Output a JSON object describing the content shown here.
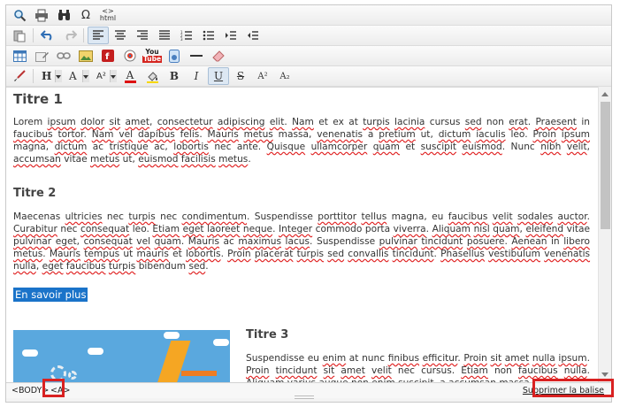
{
  "toolbar": {
    "row1": [
      {
        "name": "find-icon",
        "glyph": "🔍"
      },
      {
        "name": "print-icon",
        "glyph": "🖶"
      },
      {
        "name": "binoculars-icon",
        "glyph": "⛏"
      },
      {
        "name": "omega-icon",
        "glyph": "Ω"
      },
      {
        "name": "html-icon",
        "glyph": "<>"
      }
    ],
    "html_label": "html",
    "heading_btn": "H",
    "font_btn": "A",
    "size_btn": "A²",
    "color_btn": "A",
    "bold": "B",
    "italic": "I",
    "underline": "U",
    "strike": "S",
    "superscript": "A²",
    "subscript": "A₂",
    "youtube_top": "You",
    "youtube_bottom": "Tube"
  },
  "content": {
    "title1": "Titre 1",
    "para1": [
      {
        "t": "Lorem "
      },
      {
        "t": "ipsum",
        "u": true
      },
      {
        "t": " "
      },
      {
        "t": "dolor",
        "u": true
      },
      {
        "t": " "
      },
      {
        "t": "sit",
        "u": true
      },
      {
        "t": " "
      },
      {
        "t": "amet",
        "u": true
      },
      {
        "t": ", "
      },
      {
        "t": "consectetur",
        "u": true
      },
      {
        "t": " "
      },
      {
        "t": "adipiscing",
        "u": true
      },
      {
        "t": " "
      },
      {
        "t": "elit",
        "u": true
      },
      {
        "t": ". "
      },
      {
        "t": "Nam",
        "u": true
      },
      {
        "t": " et ex at "
      },
      {
        "t": "turpis",
        "u": true
      },
      {
        "t": " "
      },
      {
        "t": "lacinia",
        "u": true
      },
      {
        "t": " cursus "
      },
      {
        "t": "sed",
        "u": true
      },
      {
        "t": " non "
      },
      {
        "t": "erat",
        "u": true
      },
      {
        "t": ". "
      },
      {
        "t": "Praesent",
        "u": true
      },
      {
        "t": " in "
      },
      {
        "t": "faucibus",
        "u": true
      },
      {
        "t": " "
      },
      {
        "t": "tortor",
        "u": true
      },
      {
        "t": ". "
      },
      {
        "t": "Nam",
        "u": true
      },
      {
        "t": " "
      },
      {
        "t": "vel",
        "u": true
      },
      {
        "t": " "
      },
      {
        "t": "dapibus",
        "u": true
      },
      {
        "t": " "
      },
      {
        "t": "felis",
        "u": true
      },
      {
        "t": ". "
      },
      {
        "t": "Mauris",
        "u": true
      },
      {
        "t": " "
      },
      {
        "t": "metus",
        "u": true
      },
      {
        "t": " massa, "
      },
      {
        "t": "venenatis",
        "u": true
      },
      {
        "t": " a "
      },
      {
        "t": "pretium",
        "u": true
      },
      {
        "t": " ut, "
      },
      {
        "t": "dictum",
        "u": true
      },
      {
        "t": " "
      },
      {
        "t": "iaculis",
        "u": true
      },
      {
        "t": " leo. "
      },
      {
        "t": "Proin",
        "u": true
      },
      {
        "t": " "
      },
      {
        "t": "ipsum",
        "u": true
      },
      {
        "t": " magna, "
      },
      {
        "t": "dictum",
        "u": true
      },
      {
        "t": " ac "
      },
      {
        "t": "tristique",
        "u": true
      },
      {
        "t": " ac, "
      },
      {
        "t": "lobortis",
        "u": true
      },
      {
        "t": " nec ante. "
      },
      {
        "t": "Quisque",
        "u": true
      },
      {
        "t": " "
      },
      {
        "t": "ullamcorper",
        "u": true
      },
      {
        "t": " "
      },
      {
        "t": "quam",
        "u": true
      },
      {
        "t": " et "
      },
      {
        "t": "suscipit",
        "u": true
      },
      {
        "t": " "
      },
      {
        "t": "euismod",
        "u": true
      },
      {
        "t": ". Nunc "
      },
      {
        "t": "nibh",
        "u": true
      },
      {
        "t": " "
      },
      {
        "t": "velit",
        "u": true
      },
      {
        "t": ", "
      },
      {
        "t": "accumsan",
        "u": true
      },
      {
        "t": " vitae "
      },
      {
        "t": "metus",
        "u": true
      },
      {
        "t": " ut, "
      },
      {
        "t": "euismod",
        "u": true
      },
      {
        "t": " "
      },
      {
        "t": "facilisis",
        "u": true
      },
      {
        "t": " "
      },
      {
        "t": "metus",
        "u": true
      },
      {
        "t": "."
      }
    ],
    "title2": "Titre 2",
    "para2": [
      {
        "t": "Maecenas "
      },
      {
        "t": "ultricies",
        "u": true
      },
      {
        "t": " nec "
      },
      {
        "t": "turpis",
        "u": true
      },
      {
        "t": " nec "
      },
      {
        "t": "condimentum",
        "u": true
      },
      {
        "t": ". Suspendisse "
      },
      {
        "t": "porttitor",
        "u": true
      },
      {
        "t": " "
      },
      {
        "t": "tellus",
        "u": true
      },
      {
        "t": " magna, eu "
      },
      {
        "t": "faucibus",
        "u": true
      },
      {
        "t": " "
      },
      {
        "t": "velit",
        "u": true
      },
      {
        "t": " "
      },
      {
        "t": "sodales",
        "u": true
      },
      {
        "t": " "
      },
      {
        "t": "auctor",
        "u": true
      },
      {
        "t": ". "
      },
      {
        "t": "Curabitur",
        "u": true
      },
      {
        "t": " nec "
      },
      {
        "t": "consequat",
        "u": true
      },
      {
        "t": " leo. "
      },
      {
        "t": "Etiam",
        "u": true
      },
      {
        "t": " "
      },
      {
        "t": "eget",
        "u": true
      },
      {
        "t": " "
      },
      {
        "t": "laoreet",
        "u": true
      },
      {
        "t": " "
      },
      {
        "t": "neque",
        "u": true
      },
      {
        "t": ". "
      },
      {
        "t": "Integer",
        "u": true
      },
      {
        "t": " commodo porta "
      },
      {
        "t": "viverra",
        "u": true
      },
      {
        "t": ". "
      },
      {
        "t": "Aliquam",
        "u": true
      },
      {
        "t": " "
      },
      {
        "t": "nisl",
        "u": true
      },
      {
        "t": " "
      },
      {
        "t": "quam",
        "u": true
      },
      {
        "t": ", "
      },
      {
        "t": "eleifend",
        "u": true
      },
      {
        "t": " vitae "
      },
      {
        "t": "pulvinar",
        "u": true
      },
      {
        "t": " "
      },
      {
        "t": "eget",
        "u": true
      },
      {
        "t": ", "
      },
      {
        "t": "consequat",
        "u": true
      },
      {
        "t": " "
      },
      {
        "t": "vel",
        "u": true
      },
      {
        "t": " "
      },
      {
        "t": "quam",
        "u": true
      },
      {
        "t": ". "
      },
      {
        "t": "Mauris",
        "u": true
      },
      {
        "t": " ac "
      },
      {
        "t": "maximus",
        "u": true
      },
      {
        "t": " "
      },
      {
        "t": "lacus",
        "u": true
      },
      {
        "t": ". Suspendisse "
      },
      {
        "t": "pulvinar",
        "u": true
      },
      {
        "t": " "
      },
      {
        "t": "tincidunt",
        "u": true
      },
      {
        "t": " "
      },
      {
        "t": "posuere",
        "u": true
      },
      {
        "t": ". "
      },
      {
        "t": "Aenean",
        "u": true
      },
      {
        "t": " in "
      },
      {
        "t": "libero",
        "u": true
      },
      {
        "t": " "
      },
      {
        "t": "metus",
        "u": true
      },
      {
        "t": ". "
      },
      {
        "t": "Mauris",
        "u": true
      },
      {
        "t": " "
      },
      {
        "t": "tempus",
        "u": true
      },
      {
        "t": " ut "
      },
      {
        "t": "mauris",
        "u": true
      },
      {
        "t": " et "
      },
      {
        "t": "lobortis",
        "u": true
      },
      {
        "t": ". "
      },
      {
        "t": "Proin",
        "u": true
      },
      {
        "t": " "
      },
      {
        "t": "placerat",
        "u": true
      },
      {
        "t": " "
      },
      {
        "t": "turpis",
        "u": true
      },
      {
        "t": " "
      },
      {
        "t": "sed",
        "u": true
      },
      {
        "t": " "
      },
      {
        "t": "convallis",
        "u": true
      },
      {
        "t": " "
      },
      {
        "t": "tincidunt",
        "u": true
      },
      {
        "t": ". "
      },
      {
        "t": "Phasellus",
        "u": true
      },
      {
        "t": " "
      },
      {
        "t": "vestibulum",
        "u": true
      },
      {
        "t": " "
      },
      {
        "t": "venenatis",
        "u": true
      },
      {
        "t": " "
      },
      {
        "t": "nulla",
        "u": true
      },
      {
        "t": ", "
      },
      {
        "t": "eget",
        "u": true
      },
      {
        "t": " "
      },
      {
        "t": "faucibus",
        "u": true
      },
      {
        "t": " "
      },
      {
        "t": "turpis",
        "u": true
      },
      {
        "t": " bibendum "
      },
      {
        "t": "sed",
        "u": true
      },
      {
        "t": "."
      }
    ],
    "link": "En savoir plus",
    "title3": "Titre 3",
    "para3": [
      {
        "t": "Suspendisse eu "
      },
      {
        "t": "enim",
        "u": true
      },
      {
        "t": " at nunc "
      },
      {
        "t": "finibus",
        "u": true
      },
      {
        "t": " "
      },
      {
        "t": "efficitur",
        "u": true
      },
      {
        "t": ". "
      },
      {
        "t": "Proin",
        "u": true
      },
      {
        "t": " "
      },
      {
        "t": "sit",
        "u": true
      },
      {
        "t": " "
      },
      {
        "t": "amet",
        "u": true
      },
      {
        "t": " "
      },
      {
        "t": "nulla",
        "u": true
      },
      {
        "t": " "
      },
      {
        "t": "ipsum",
        "u": true
      },
      {
        "t": ". "
      },
      {
        "t": "Proin",
        "u": true
      },
      {
        "t": " "
      },
      {
        "t": "tincidunt",
        "u": true
      },
      {
        "t": " "
      },
      {
        "t": "sit",
        "u": true
      },
      {
        "t": " "
      },
      {
        "t": "amet",
        "u": true
      },
      {
        "t": " "
      },
      {
        "t": "velit",
        "u": true
      },
      {
        "t": " nec cursus. "
      },
      {
        "t": "Etiam",
        "u": true
      },
      {
        "t": " non "
      },
      {
        "t": "faucibus",
        "u": true
      },
      {
        "t": " "
      },
      {
        "t": "nulla",
        "u": true
      },
      {
        "t": ". "
      },
      {
        "t": "Aliquam",
        "u": true
      },
      {
        "t": " "
      },
      {
        "t": "varius",
        "u": true
      },
      {
        "t": " "
      },
      {
        "t": "augue",
        "u": true
      },
      {
        "t": " non "
      },
      {
        "t": "enim",
        "u": true
      },
      {
        "t": " "
      },
      {
        "t": "suscipit",
        "u": true
      },
      {
        "t": ", a "
      },
      {
        "t": "accumsan",
        "u": true
      },
      {
        "t": " massa"
      }
    ]
  },
  "statusbar": {
    "body_tag": "<BODY>",
    "a_tag": "<A>",
    "remove_tag": "Supprimer la balise"
  },
  "colors": {
    "highlight_red": "#d92121",
    "link_selection": "#1a73c9",
    "spell_underline": "#e02020"
  }
}
